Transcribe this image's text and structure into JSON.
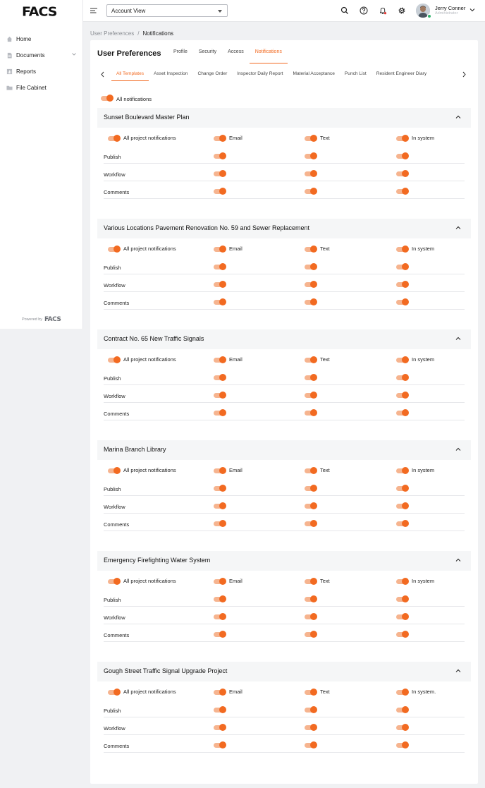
{
  "app": {
    "logo": "FACS",
    "powered_by_label": "Powered by",
    "powered_by_brand": "FACS"
  },
  "sidebar": {
    "items": [
      {
        "label": "Home",
        "icon": "home-icon"
      },
      {
        "label": "Documents",
        "icon": "document-icon",
        "expandable": true
      },
      {
        "label": "Reports",
        "icon": "reports-icon"
      },
      {
        "label": "File Cabinet",
        "icon": "folder-icon"
      }
    ]
  },
  "topbar": {
    "view_select": "Account View",
    "user_name": "Jerry Conner",
    "user_role": "Administrator"
  },
  "breadcrumb": {
    "parent": "User Preferences",
    "separator": "/",
    "current": "Notifications"
  },
  "page": {
    "title": "User Preferences",
    "tabs": [
      {
        "label": "Profile",
        "active": false
      },
      {
        "label": "Security",
        "active": false
      },
      {
        "label": "Access",
        "active": false
      },
      {
        "label": "Notifications",
        "active": true
      }
    ]
  },
  "templates": {
    "tabs": [
      {
        "label": "All Templates",
        "active": true
      },
      {
        "label": "Asset Inspection",
        "active": false
      },
      {
        "label": "Change Order",
        "active": false
      },
      {
        "label": "Inspector Daily Report",
        "active": false
      },
      {
        "label": "Material Acceptance",
        "active": false
      },
      {
        "label": "Punch List",
        "active": false
      },
      {
        "label": "Resident Engineer Diary",
        "active": false
      }
    ]
  },
  "all_notifications": {
    "label": "All notifications",
    "on": true
  },
  "columns": {
    "all": "All project notifications",
    "email": "Email",
    "text": "Text",
    "in_system": "In system"
  },
  "rows": [
    "Publish",
    "Workflow",
    "Comments"
  ],
  "projects": [
    {
      "title": "Sunset Boulevard Master Plan",
      "in_system_label": "In system"
    },
    {
      "title": "Various Locations Pavement Renovation No. 59 and Sewer Replacement",
      "in_system_label": "In system"
    },
    {
      "title": "Contract No. 65 New Traffic Signals",
      "in_system_label": "In system"
    },
    {
      "title": "Marina Branch Library",
      "in_system_label": "In system"
    },
    {
      "title": "Emergency Firefighting Water System",
      "in_system_label": "In system"
    },
    {
      "title": "Gough Street Traffic Signal Upgrade Project",
      "in_system_label": "In system."
    }
  ],
  "colors": {
    "accent": "#f26a21",
    "accent_light": "#f6b48f",
    "online": "#2fb36a"
  }
}
